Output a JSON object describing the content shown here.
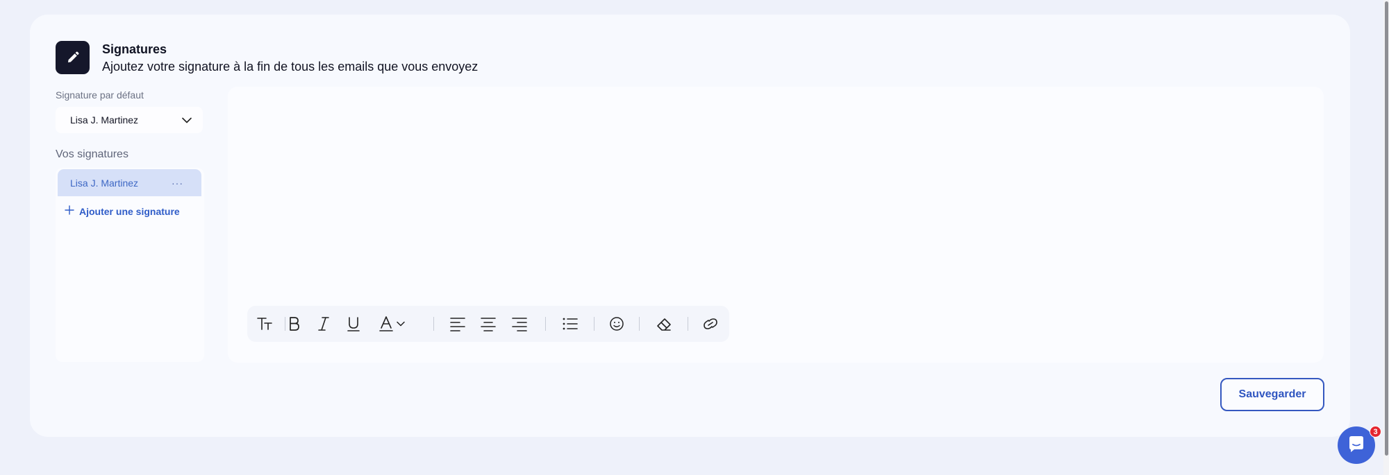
{
  "header": {
    "title": "Signatures",
    "subtitle": "Ajoutez votre signature à la fin de tous les emails que vous envoyez",
    "icon": "pencil-icon"
  },
  "default_signature": {
    "label": "Signature par défaut",
    "selected": "Lisa J. Martinez"
  },
  "signatures": {
    "label": "Vos signatures",
    "items": [
      {
        "name": "Lisa J. Martinez",
        "menu": "···"
      }
    ],
    "add_label": "Ajouter une signature"
  },
  "toolbar": {
    "tools": [
      "text-size-icon",
      "bold-icon",
      "italic-icon",
      "underline-icon",
      "text-color-icon",
      "align-left-icon",
      "align-center-icon",
      "align-right-icon",
      "bullet-list-icon",
      "emoji-icon",
      "eraser-icon",
      "link-icon"
    ]
  },
  "save_label": "Sauvegarder",
  "chat": {
    "badge_count": "3"
  },
  "colors": {
    "accent": "#2f55c0",
    "dark": "#15172b",
    "badge": "#e5252f"
  }
}
